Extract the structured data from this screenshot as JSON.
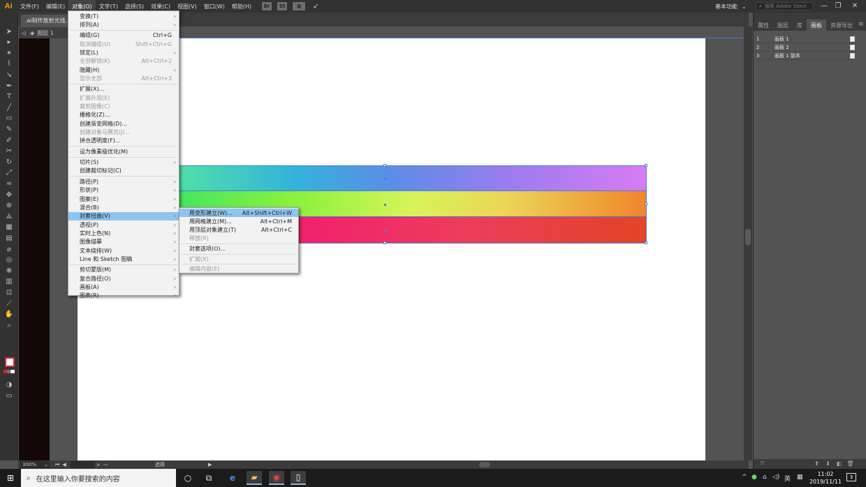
{
  "app": {
    "logo": "Ai",
    "menus": [
      "文件(F)",
      "编辑(E)",
      "对象(O)",
      "文字(T)",
      "选择(S)",
      "效果(C)",
      "视图(V)",
      "窗口(W)",
      "帮助(H)"
    ],
    "active_menu_index": 2,
    "bridge_label": "Br",
    "stock_label": "St",
    "workspace": "基本功能",
    "search_placeholder": "搜索 Adobe Stock",
    "window_buttons": [
      "—",
      "❐",
      "✕"
    ]
  },
  "document": {
    "tab_title": ".ai制作放射光线.ai*",
    "layer_label": "图层 1",
    "colors": {
      "band_top_start": "#4fe0a8",
      "band_mid_end": "#f0862c",
      "band_bottom_start": "#f21a6a",
      "selection": "#4b7cd8"
    }
  },
  "object_menu": [
    {
      "label": "变换(T)",
      "shortcut": "",
      "arrow": true,
      "disabled": false
    },
    {
      "label": "排列(A)",
      "shortcut": "",
      "arrow": true,
      "disabled": false
    },
    {
      "sep": true
    },
    {
      "label": "编组(G)",
      "shortcut": "Ctrl+G",
      "arrow": false,
      "disabled": false
    },
    {
      "label": "取消编组(U)",
      "shortcut": "Shift+Ctrl+G",
      "arrow": false,
      "disabled": true
    },
    {
      "label": "锁定(L)",
      "shortcut": "",
      "arrow": true,
      "disabled": false
    },
    {
      "label": "全部解锁(K)",
      "shortcut": "Alt+Ctrl+2",
      "arrow": false,
      "disabled": true
    },
    {
      "label": "隐藏(H)",
      "shortcut": "",
      "arrow": true,
      "disabled": false
    },
    {
      "label": "显示全部",
      "shortcut": "Alt+Ctrl+3",
      "arrow": false,
      "disabled": true
    },
    {
      "sep": true
    },
    {
      "label": "扩展(X)...",
      "shortcut": "",
      "arrow": false,
      "disabled": false
    },
    {
      "label": "扩展外观(E)",
      "shortcut": "",
      "arrow": false,
      "disabled": true
    },
    {
      "label": "裁剪图像(C)",
      "shortcut": "",
      "arrow": false,
      "disabled": true
    },
    {
      "label": "栅格化(Z)...",
      "shortcut": "",
      "arrow": false,
      "disabled": false
    },
    {
      "label": "创建渐变网格(D)...",
      "shortcut": "",
      "arrow": false,
      "disabled": false
    },
    {
      "label": "创建对象马赛克(J)...",
      "shortcut": "",
      "arrow": false,
      "disabled": true
    },
    {
      "label": "拼合透明度(F)...",
      "shortcut": "",
      "arrow": false,
      "disabled": false
    },
    {
      "sep": true
    },
    {
      "label": "设为像素级优化(M)",
      "shortcut": "",
      "arrow": false,
      "disabled": false
    },
    {
      "sep": true
    },
    {
      "label": "切片(S)",
      "shortcut": "",
      "arrow": true,
      "disabled": false
    },
    {
      "label": "创建裁切标记(C)",
      "shortcut": "",
      "arrow": false,
      "disabled": false
    },
    {
      "sep": true
    },
    {
      "label": "路径(P)",
      "shortcut": "",
      "arrow": true,
      "disabled": false
    },
    {
      "label": "形状(P)",
      "shortcut": "",
      "arrow": true,
      "disabled": false
    },
    {
      "label": "图案(E)",
      "shortcut": "",
      "arrow": true,
      "disabled": false
    },
    {
      "label": "混合(B)",
      "shortcut": "",
      "arrow": true,
      "disabled": false
    },
    {
      "label": "封套扭曲(V)",
      "shortcut": "",
      "arrow": true,
      "disabled": false,
      "highlight": true
    },
    {
      "label": "透视(P)",
      "shortcut": "",
      "arrow": true,
      "disabled": false
    },
    {
      "label": "实时上色(N)",
      "shortcut": "",
      "arrow": true,
      "disabled": false
    },
    {
      "label": "图像描摹",
      "shortcut": "",
      "arrow": true,
      "disabled": false
    },
    {
      "label": "文本绕排(W)",
      "shortcut": "",
      "arrow": true,
      "disabled": false
    },
    {
      "label": "Line 和 Sketch 图稿",
      "shortcut": "",
      "arrow": true,
      "disabled": false
    },
    {
      "sep": true
    },
    {
      "label": "剪切蒙版(M)",
      "shortcut": "",
      "arrow": true,
      "disabled": false
    },
    {
      "label": "复合路径(O)",
      "shortcut": "",
      "arrow": true,
      "disabled": false
    },
    {
      "label": "画板(A)",
      "shortcut": "",
      "arrow": true,
      "disabled": false
    },
    {
      "label": "图表(R)",
      "shortcut": "",
      "arrow": true,
      "disabled": false
    }
  ],
  "envelope_submenu": [
    {
      "label": "用变形建立(W)...",
      "shortcut": "Alt+Shift+Ctrl+W",
      "disabled": false,
      "highlight": true
    },
    {
      "label": "用网格建立(M)...",
      "shortcut": "Alt+Ctrl+M",
      "disabled": false
    },
    {
      "label": "用顶层对象建立(T)",
      "shortcut": "Alt+Ctrl+C",
      "disabled": false
    },
    {
      "label": "释放(R)",
      "shortcut": "",
      "disabled": true
    },
    {
      "sep": true
    },
    {
      "label": "封套选项(O)...",
      "shortcut": "",
      "disabled": false
    },
    {
      "sep": true
    },
    {
      "label": "扩展(X)",
      "shortcut": "",
      "disabled": true
    },
    {
      "sep": true
    },
    {
      "label": "编辑内容(E)",
      "shortcut": "",
      "disabled": true
    }
  ],
  "panel": {
    "tabs": [
      "属性",
      "图层",
      "库",
      "画板",
      "资源导出"
    ],
    "active_tab_index": 3,
    "artboards": [
      {
        "num": "1",
        "name": "画板 1"
      },
      {
        "num": "2",
        "name": "画板 2"
      },
      {
        "num": "3",
        "name": "画板 1 副本"
      }
    ]
  },
  "status": {
    "zoom": "300%",
    "mode": "选择"
  },
  "taskbar": {
    "search_placeholder": "在这里输入你要搜索的内容",
    "time": "11:02",
    "date": "2019/11/11",
    "lang": "英",
    "notifications": "3"
  }
}
